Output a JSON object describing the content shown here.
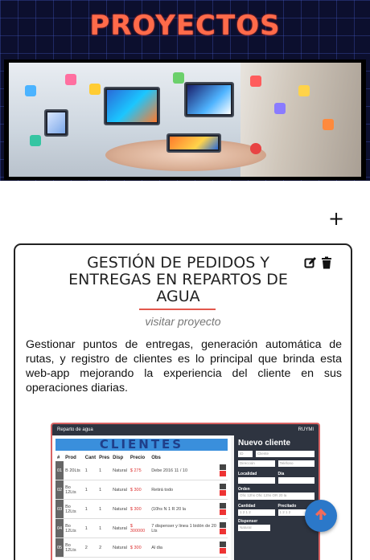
{
  "header": {
    "title": "PROYECTOS",
    "title_color": "#ff6b4a",
    "background_color": "#0c0f2e"
  },
  "add_button": {
    "label": "+"
  },
  "project_card": {
    "title": "GESTIÓN DE PEDIDOS Y ENTREGAS EN REPARTOS DE AGUA",
    "link_label": "visitar proyecto",
    "description": "Gestionar puntos de entregas, generación automática de rutas, y registro de clientes es lo principal que brinda esta web-app mejorando la experiencia del cliente en sus operaciones diarias.",
    "accent_color": "#e2574c",
    "icons": [
      "edit-icon",
      "trash-icon"
    ],
    "preview": {
      "app_title": "Reparto de agua",
      "app_user": "RUYMI",
      "heading": "CLIENTES",
      "columns": [
        "#",
        "Prod",
        "Cant",
        "Pres",
        "Disp",
        "Precio",
        "Obs"
      ],
      "rows": [
        [
          "01",
          "B 20Lts",
          "1",
          "1",
          "Natural",
          "$ 275",
          "Debe 2016 11 / 10"
        ],
        [
          "02",
          "Bo 12Lts",
          "1",
          "1",
          "Natural",
          "$ 300",
          "Retirá todo"
        ],
        [
          "03",
          "Bo 12Lts",
          "1",
          "1",
          "Natural",
          "$ 300",
          "(10hs N 1 R 20 la"
        ],
        [
          "04",
          "Bo 12Lts",
          "1",
          "1",
          "Natural",
          "$ 300000",
          "7 dispenser y linea 1 bidón de 20 Lts"
        ],
        [
          "05",
          "Bo 12Lts",
          "2",
          "2",
          "Natural",
          "$ 300",
          "Al dia"
        ]
      ],
      "form": {
        "title": "Nuevo cliente",
        "id_placeholder": "ID",
        "client_placeholder": "Cliente",
        "address_placeholder": "Dirección",
        "phone_placeholder": "Teléfono",
        "locality_label": "Localidad",
        "day_label": "Día",
        "schedule_label": "Orden",
        "schedule_value": "Ofic 12hs Ofic 12hs OR 20 la",
        "quantity_label": "Cantidad",
        "price_label": "Precitado",
        "quantity_value": "1 2 1 2",
        "price_value": "1 2 1 2",
        "dispenser_label": "Dispenser",
        "dispenser_value": "Natural"
      }
    }
  },
  "fab": {
    "icon": "arrow-up-icon",
    "color": "#2b78c9"
  }
}
